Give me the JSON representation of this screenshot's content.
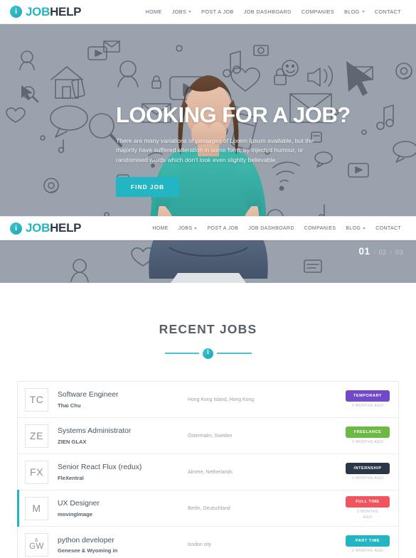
{
  "brand": {
    "name_first": "JOB",
    "name_second": "HELP",
    "icon": "info-circle-icon",
    "icon_glyph": "i",
    "color_teal": "#22b6c4",
    "color_navy": "#2e3a47"
  },
  "nav": {
    "items": [
      {
        "label": "HOME",
        "dropdown": false
      },
      {
        "label": "JOBS",
        "dropdown": true
      },
      {
        "label": "POST A JOB",
        "dropdown": false
      },
      {
        "label": "JOB DASHBOARD",
        "dropdown": false
      },
      {
        "label": "COMPANIES",
        "dropdown": false
      },
      {
        "label": "BLOG",
        "dropdown": true
      },
      {
        "label": "CONTACT",
        "dropdown": false
      }
    ]
  },
  "hero": {
    "title": "LOOKING FOR A JOB?",
    "subtitle": "There are many variations of passages of Lorem Ipsum available, but the majority have suffered alteration in some form, by injected humour, or randomised words which don't look even slightly believable.",
    "cta_label": "FIND JOB",
    "background_color": "#9aa3ad",
    "pagination": [
      {
        "label": "01",
        "active": true
      },
      {
        "label": "02",
        "active": false
      },
      {
        "label": "03",
        "active": false
      }
    ],
    "pagination_separator": "/"
  },
  "section": {
    "title": "RECENT JOBS",
    "divider_icon": "info-circle-icon",
    "divider_glyph": "i"
  },
  "jobs": {
    "date_label": "3 MONTHS AGO",
    "rows": [
      {
        "avatar": "TC",
        "title": "Software Engineer",
        "company": "Thai Chu",
        "location": "Hong Kong Island, Hong Kong",
        "badge": "TEMPORARY",
        "badge_color": "#7048c8",
        "date": "3 MONTHS AGO",
        "featured": false
      },
      {
        "avatar": "ZE",
        "title": "Systems Administrator",
        "company": "ZIEN GLAX",
        "location": "Östermalm, Sweden",
        "badge": "FREELANCE",
        "badge_color": "#6cb944",
        "date": "3 MONTHS AGO",
        "featured": false
      },
      {
        "avatar": "FX",
        "title": "Senior React Flux (redux)",
        "company": "FleXentral",
        "location": "Almere, Netherlands",
        "badge": "INTERNSHIP",
        "badge_color": "#2b3648",
        "date": "3 MONTHS AGO",
        "featured": false
      },
      {
        "avatar": "M",
        "title": "UX Designer",
        "company": "movingImage",
        "location": "Berlin, Deutschland",
        "badge": "FULL TIME",
        "badge_color": "#f0545f",
        "date": "3 MONTHS AGO",
        "featured": true
      },
      {
        "avatar": "GW",
        "avatar_amp": "&",
        "title": "python developer",
        "company": "Genesee & Wyoming in",
        "location": "london city",
        "badge": "PART TIME",
        "badge_color": "#22b6c4",
        "date": "3 MONTHS AGO",
        "featured": false
      }
    ]
  }
}
